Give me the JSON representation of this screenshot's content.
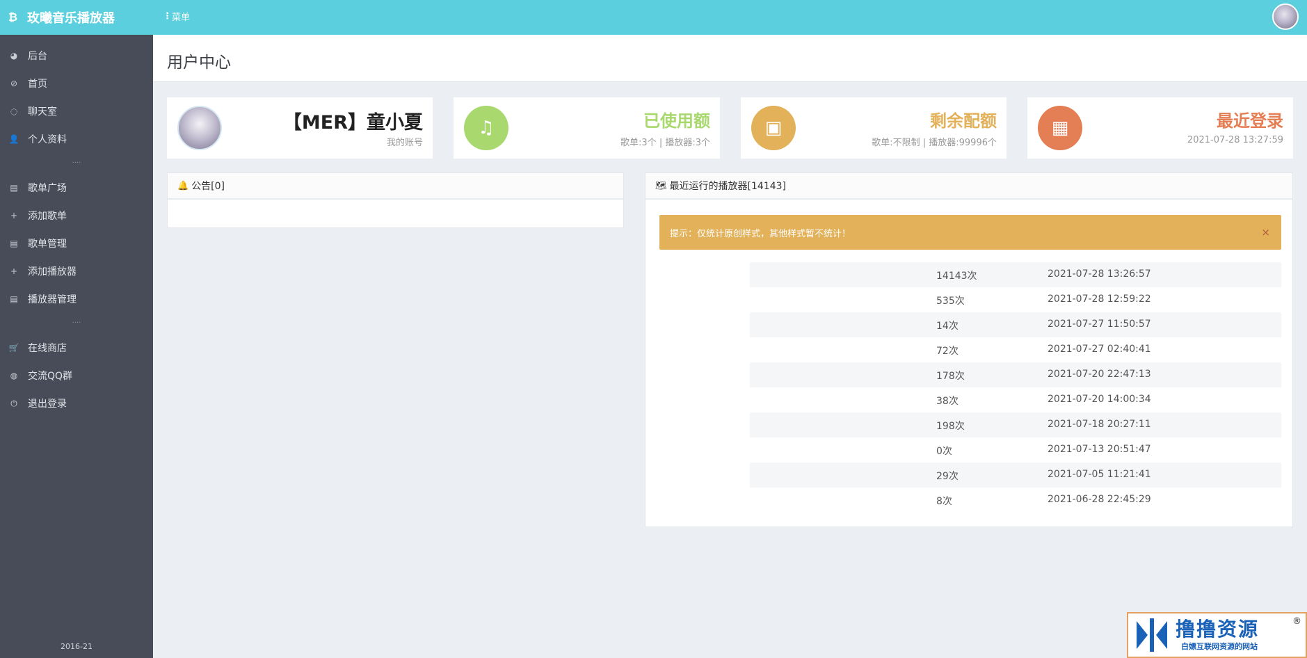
{
  "header": {
    "brand_icon": "bitcoin-icon",
    "brand": "玫曦音乐播放器",
    "menu_label": "菜单"
  },
  "sidebar": {
    "items": [
      {
        "label": "后台",
        "icon": "pie-chart-icon"
      },
      {
        "label": "首页",
        "icon": "dashboard-icon"
      },
      {
        "label": "聊天室",
        "icon": "chat-icon"
      },
      {
        "label": "个人资料",
        "icon": "user-icon"
      },
      {
        "label": "歌单广场",
        "icon": "table-icon"
      },
      {
        "label": "添加歌单",
        "icon": "plus-icon"
      },
      {
        "label": "歌单管理",
        "icon": "table-icon"
      },
      {
        "label": "添加播放器",
        "icon": "plus-icon"
      },
      {
        "label": "播放器管理",
        "icon": "table-icon"
      },
      {
        "label": "在线商店",
        "icon": "cart-icon"
      },
      {
        "label": "交流QQ群",
        "icon": "globe-icon"
      },
      {
        "label": "退出登录",
        "icon": "power-icon"
      }
    ],
    "separator": "....",
    "footer": "2016-21"
  },
  "page": {
    "title": "用户中心"
  },
  "cards": {
    "account": {
      "title": "【MER】童小夏",
      "sub": "我的账号"
    },
    "used": {
      "title": "已使用额",
      "sub": "歌单:3个 | 播放器:3个",
      "color": "#a9d86e"
    },
    "remaining": {
      "title": "剩余配额",
      "sub": "歌单:不限制 | 播放器:99996个",
      "color": "#e2b159"
    },
    "login": {
      "title": "最近登录",
      "sub": "2021-07-28 13:27:59",
      "color": "#e47e55"
    }
  },
  "notice": {
    "title": "公告[0]"
  },
  "players": {
    "title": "最近运行的播放器[14143]",
    "alert": "提示：仅统计原创样式，其他样式暂不统计！",
    "close": "×",
    "rows": [
      {
        "count": "14143次",
        "time": "2021-07-28 13:26:57"
      },
      {
        "count": "535次",
        "time": "2021-07-28 12:59:22"
      },
      {
        "count": "14次",
        "time": "2021-07-27 11:50:57"
      },
      {
        "count": "72次",
        "time": "2021-07-27 02:40:41"
      },
      {
        "count": "178次",
        "time": "2021-07-20 22:47:13"
      },
      {
        "count": "38次",
        "time": "2021-07-20 14:00:34"
      },
      {
        "count": "198次",
        "time": "2021-07-18 20:27:11"
      },
      {
        "count": "0次",
        "time": "2021-07-13 20:51:47"
      },
      {
        "count": "29次",
        "time": "2021-07-05 11:21:41"
      },
      {
        "count": "8次",
        "time": "2021-06-28 22:45:29"
      }
    ]
  },
  "watermark": {
    "title": "撸撸资源",
    "sub": "白嫖互联网资源的网站",
    "reg": "®"
  }
}
